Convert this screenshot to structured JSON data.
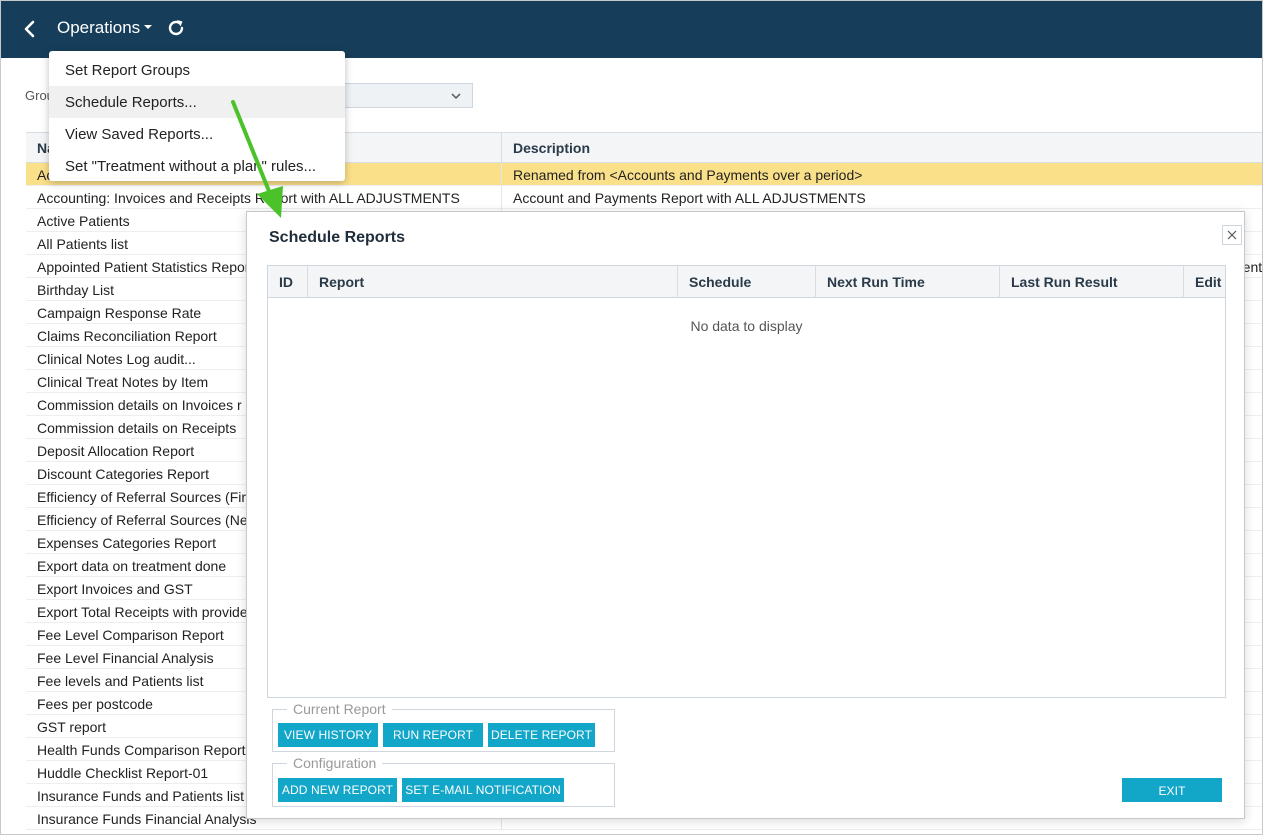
{
  "topbar": {
    "menu_label": "Operations",
    "icons": {
      "back": "chevron-left-icon",
      "caret": "caret-down-icon",
      "refresh": "refresh-icon"
    },
    "background": "#163e5a"
  },
  "group": {
    "label": "Grou",
    "selected_value": ""
  },
  "dropdown": {
    "items": [
      {
        "label": "Set Report Groups"
      },
      {
        "label": "Schedule Reports..."
      },
      {
        "label": "View Saved Reports..."
      },
      {
        "label": "Set \"Treatment without a plan\" rules..."
      }
    ]
  },
  "report_table": {
    "headers": [
      "Na",
      "Description"
    ],
    "rows": [
      {
        "name": "Ac",
        "description": "Renamed from <Accounts and Payments over a period>"
      },
      {
        "name": "Accounting: Invoices and Receipts Report with ALL ADJUSTMENTS",
        "description": "Account and Payments Report with ALL ADJUSTMENTS"
      },
      {
        "name": "Active Patients",
        "description": ""
      },
      {
        "name": "All Patients list",
        "description": ""
      },
      {
        "name": "Appointed Patient Statistics Report",
        "description": "ment"
      },
      {
        "name": "Birthday List",
        "description": ""
      },
      {
        "name": "Campaign Response Rate",
        "description": ""
      },
      {
        "name": "Claims Reconciliation Report",
        "description": ""
      },
      {
        "name": "Clinical Notes Log audit...",
        "description": ""
      },
      {
        "name": "Clinical Treat Notes by Item",
        "description": ""
      },
      {
        "name": "Commission details on Invoices r",
        "description": ""
      },
      {
        "name": "Commission details on Receipts",
        "description": ""
      },
      {
        "name": "Deposit Allocation Report",
        "description": ""
      },
      {
        "name": "Discount Categories Report",
        "description": ""
      },
      {
        "name": "Efficiency of Referral Sources (Fir",
        "description": ""
      },
      {
        "name": "Efficiency of Referral Sources (Ne",
        "description": ""
      },
      {
        "name": "Expenses Categories Report",
        "description": ""
      },
      {
        "name": "Export data on treatment done",
        "description": ""
      },
      {
        "name": "Export Invoices and GST",
        "description": ""
      },
      {
        "name": "Export Total Receipts with provide",
        "description": ""
      },
      {
        "name": "Fee Level Comparison Report",
        "description": ""
      },
      {
        "name": "Fee Level Financial Analysis",
        "description": ""
      },
      {
        "name": "Fee levels and Patients list",
        "description": ""
      },
      {
        "name": "Fees per postcode",
        "description": ""
      },
      {
        "name": "GST report",
        "description": ""
      },
      {
        "name": "Health Funds Comparison Report",
        "description": ""
      },
      {
        "name": "Huddle Checklist Report-01",
        "description": ""
      },
      {
        "name": "Insurance Funds and Patients list",
        "description": ""
      },
      {
        "name": "Insurance Funds Financial Analysis",
        "description": ""
      }
    ]
  },
  "modal": {
    "title": "Schedule Reports",
    "grid_headers": [
      "ID",
      "Report",
      "Schedule",
      "Next Run Time",
      "Last Run Result",
      "Edit"
    ],
    "empty_text": "No data to display",
    "current_report": {
      "legend": "Current Report",
      "buttons": [
        "VIEW HISTORY",
        "RUN REPORT",
        "DELETE REPORT"
      ]
    },
    "configuration": {
      "legend": "Configuration",
      "buttons": [
        "ADD NEW REPORT",
        "SET E-MAIL NOTIFICATION"
      ]
    },
    "exit_label": "EXIT",
    "accent": "#12a6c9"
  },
  "annotation": {
    "color": "#4cc22a",
    "icon": "green-arrow"
  }
}
